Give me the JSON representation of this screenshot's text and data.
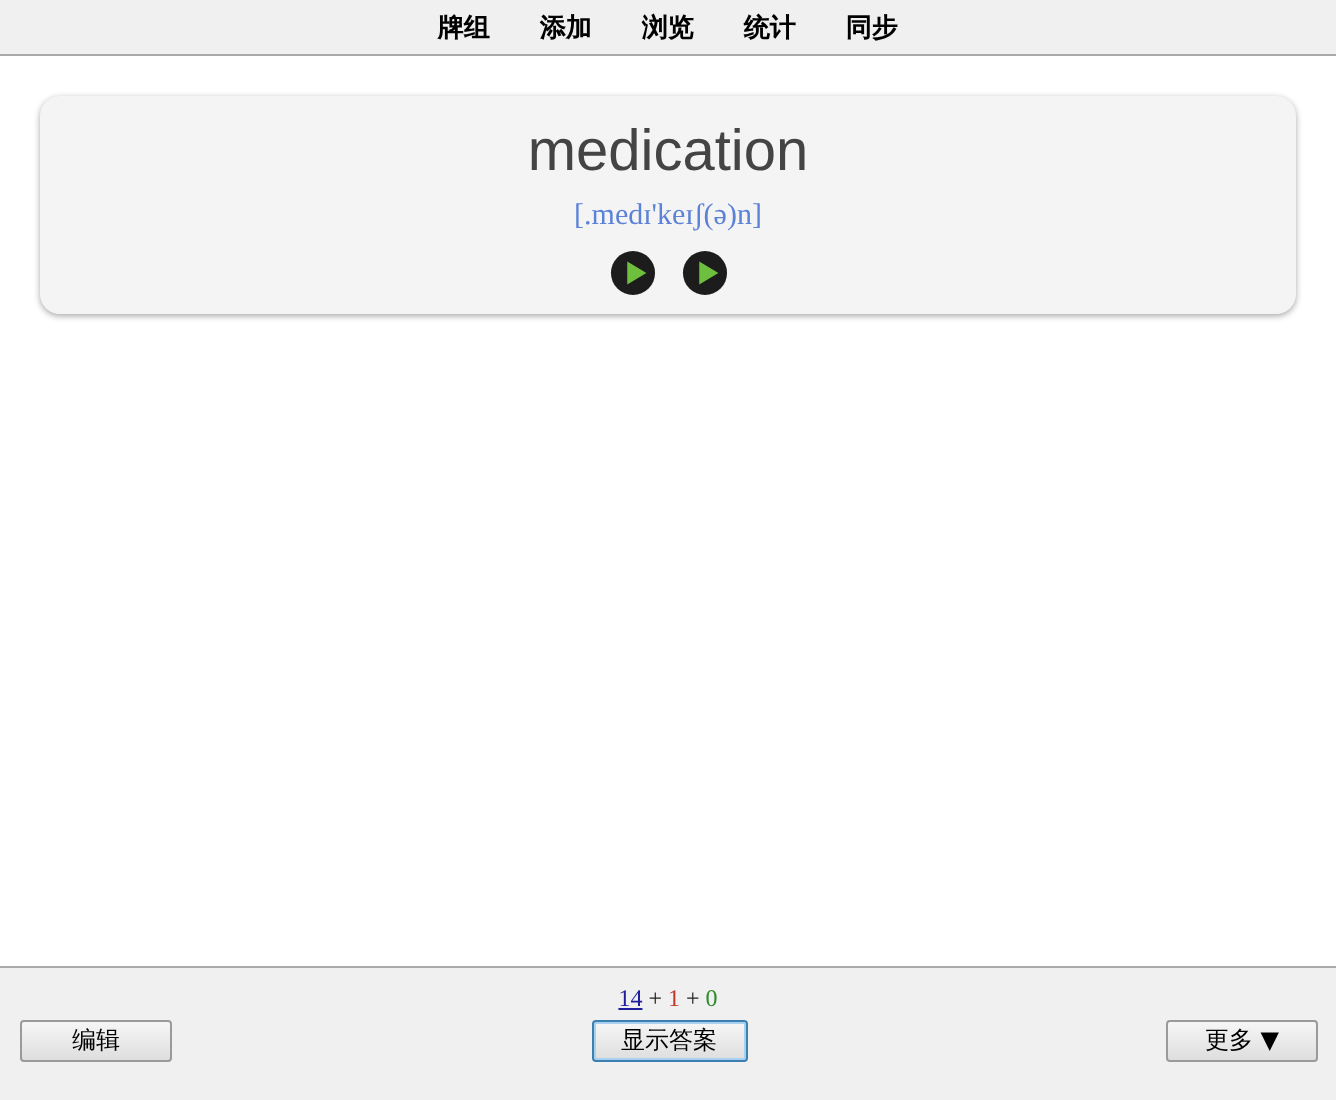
{
  "nav": [
    {
      "label": "牌组"
    },
    {
      "label": "添加"
    },
    {
      "label": "浏览"
    },
    {
      "label": "统计"
    },
    {
      "label": "同步"
    }
  ],
  "card": {
    "word": "medication",
    "phonetic": "[.medɪ'keɪʃ(ə)n]",
    "play_buttons": [
      {
        "kind": "play"
      },
      {
        "kind": "play"
      }
    ]
  },
  "counts": [
    {
      "kind": "count",
      "text": "14",
      "color": "#1f1f9e",
      "underlined": true
    },
    {
      "kind": "separator",
      "text": "+"
    },
    {
      "kind": "count",
      "text": "1",
      "color": "#c0392b",
      "underlined": false
    },
    {
      "kind": "separator",
      "text": "+"
    },
    {
      "kind": "count",
      "text": "0",
      "color": "#2e8b2e",
      "underlined": false
    }
  ],
  "buttons": [
    {
      "label": "编辑",
      "focused": false
    },
    {
      "label": "显示答案",
      "focused": true
    },
    {
      "label": "更多 ▼",
      "focused": false
    }
  ]
}
